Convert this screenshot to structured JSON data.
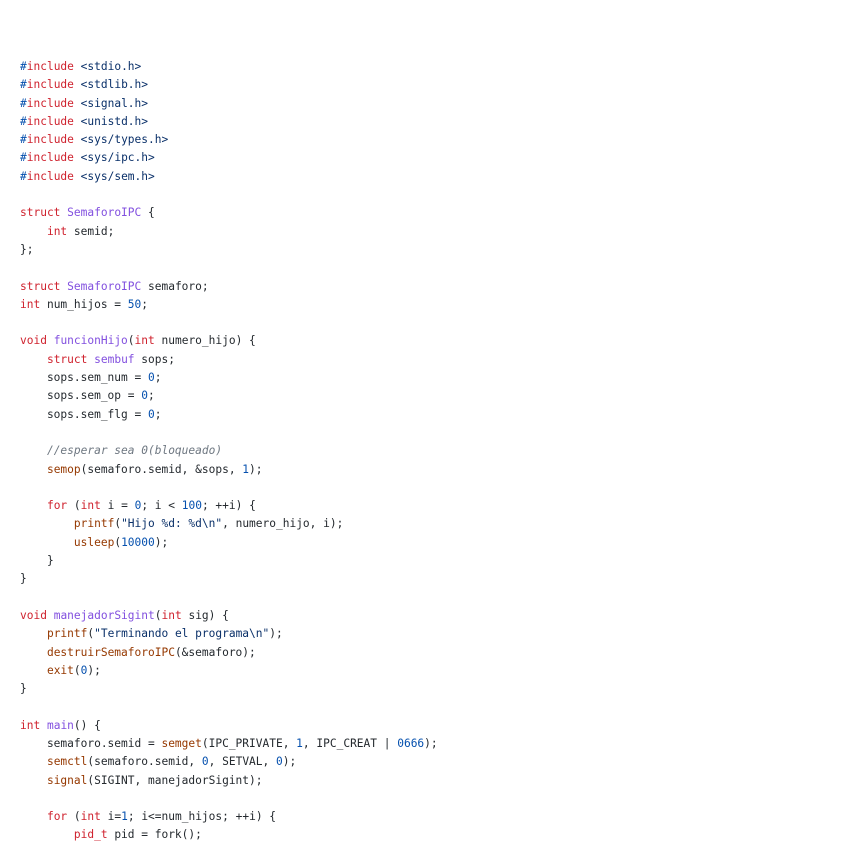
{
  "colors": {
    "background": "#ffffff",
    "text": "#24292e",
    "keyword": "#cf222e",
    "preprocessor": "#0550ae",
    "type_name": "#8250df",
    "function_call": "#953800",
    "number": "#0550ae",
    "string": "#0a3069",
    "comment": "#6e7781"
  },
  "code": {
    "lines": [
      [
        {
          "c": "pp",
          "t": "#"
        },
        {
          "c": "kw",
          "t": "include"
        },
        {
          "c": "tx",
          "t": " "
        },
        {
          "c": "hdr",
          "t": "<stdio.h>"
        }
      ],
      [
        {
          "c": "pp",
          "t": "#"
        },
        {
          "c": "kw",
          "t": "include"
        },
        {
          "c": "tx",
          "t": " "
        },
        {
          "c": "hdr",
          "t": "<stdlib.h>"
        }
      ],
      [
        {
          "c": "pp",
          "t": "#"
        },
        {
          "c": "kw",
          "t": "include"
        },
        {
          "c": "tx",
          "t": " "
        },
        {
          "c": "hdr",
          "t": "<signal.h>"
        }
      ],
      [
        {
          "c": "pp",
          "t": "#"
        },
        {
          "c": "kw",
          "t": "include"
        },
        {
          "c": "tx",
          "t": " "
        },
        {
          "c": "hdr",
          "t": "<unistd.h>"
        }
      ],
      [
        {
          "c": "pp",
          "t": "#"
        },
        {
          "c": "kw",
          "t": "include"
        },
        {
          "c": "tx",
          "t": " "
        },
        {
          "c": "hdr",
          "t": "<sys/types.h>"
        }
      ],
      [
        {
          "c": "pp",
          "t": "#"
        },
        {
          "c": "kw",
          "t": "include"
        },
        {
          "c": "tx",
          "t": " "
        },
        {
          "c": "hdr",
          "t": "<sys/ipc.h>"
        }
      ],
      [
        {
          "c": "pp",
          "t": "#"
        },
        {
          "c": "kw",
          "t": "include"
        },
        {
          "c": "tx",
          "t": " "
        },
        {
          "c": "hdr",
          "t": "<sys/sem.h>"
        }
      ],
      [],
      [
        {
          "c": "kw",
          "t": "struct"
        },
        {
          "c": "tx",
          "t": " "
        },
        {
          "c": "ty",
          "t": "SemaforoIPC"
        },
        {
          "c": "tx",
          "t": " {"
        }
      ],
      [
        {
          "c": "tx",
          "t": "    "
        },
        {
          "c": "kw",
          "t": "int"
        },
        {
          "c": "tx",
          "t": " semid;"
        }
      ],
      [
        {
          "c": "tx",
          "t": "};"
        }
      ],
      [],
      [
        {
          "c": "kw",
          "t": "struct"
        },
        {
          "c": "tx",
          "t": " "
        },
        {
          "c": "ty",
          "t": "SemaforoIPC"
        },
        {
          "c": "tx",
          "t": " semaforo;"
        }
      ],
      [
        {
          "c": "kw",
          "t": "int"
        },
        {
          "c": "tx",
          "t": " num_hijos = "
        },
        {
          "c": "num",
          "t": "50"
        },
        {
          "c": "tx",
          "t": ";"
        }
      ],
      [],
      [
        {
          "c": "kw",
          "t": "void"
        },
        {
          "c": "tx",
          "t": " "
        },
        {
          "c": "fd",
          "t": "funcionHijo"
        },
        {
          "c": "tx",
          "t": "("
        },
        {
          "c": "kw",
          "t": "int"
        },
        {
          "c": "tx",
          "t": " numero_hijo) {"
        }
      ],
      [
        {
          "c": "tx",
          "t": "    "
        },
        {
          "c": "kw",
          "t": "struct"
        },
        {
          "c": "tx",
          "t": " "
        },
        {
          "c": "ty",
          "t": "sembuf"
        },
        {
          "c": "tx",
          "t": " sops;"
        }
      ],
      [
        {
          "c": "tx",
          "t": "    sops.sem_num = "
        },
        {
          "c": "num",
          "t": "0"
        },
        {
          "c": "tx",
          "t": ";"
        }
      ],
      [
        {
          "c": "tx",
          "t": "    sops.sem_op = "
        },
        {
          "c": "num",
          "t": "0"
        },
        {
          "c": "tx",
          "t": ";"
        }
      ],
      [
        {
          "c": "tx",
          "t": "    sops.sem_flg = "
        },
        {
          "c": "num",
          "t": "0"
        },
        {
          "c": "tx",
          "t": ";"
        }
      ],
      [],
      [
        {
          "c": "tx",
          "t": "    "
        },
        {
          "c": "cm",
          "t": "//esperar sea 0(bloqueado)"
        }
      ],
      [
        {
          "c": "tx",
          "t": "    "
        },
        {
          "c": "fn",
          "t": "semop"
        },
        {
          "c": "tx",
          "t": "(semaforo.semid, &sops, "
        },
        {
          "c": "num",
          "t": "1"
        },
        {
          "c": "tx",
          "t": ");"
        }
      ],
      [],
      [
        {
          "c": "tx",
          "t": "    "
        },
        {
          "c": "kw",
          "t": "for"
        },
        {
          "c": "tx",
          "t": " ("
        },
        {
          "c": "kw",
          "t": "int"
        },
        {
          "c": "tx",
          "t": " i = "
        },
        {
          "c": "num",
          "t": "0"
        },
        {
          "c": "tx",
          "t": "; i < "
        },
        {
          "c": "num",
          "t": "100"
        },
        {
          "c": "tx",
          "t": "; ++i) {"
        }
      ],
      [
        {
          "c": "tx",
          "t": "        "
        },
        {
          "c": "fn",
          "t": "printf"
        },
        {
          "c": "tx",
          "t": "("
        },
        {
          "c": "str",
          "t": "\"Hijo %d: %d\\n\""
        },
        {
          "c": "tx",
          "t": ", numero_hijo, i);"
        }
      ],
      [
        {
          "c": "tx",
          "t": "        "
        },
        {
          "c": "fn",
          "t": "usleep"
        },
        {
          "c": "tx",
          "t": "("
        },
        {
          "c": "num",
          "t": "10000"
        },
        {
          "c": "tx",
          "t": ");"
        }
      ],
      [
        {
          "c": "tx",
          "t": "    }"
        }
      ],
      [
        {
          "c": "tx",
          "t": "}"
        }
      ],
      [],
      [
        {
          "c": "kw",
          "t": "void"
        },
        {
          "c": "tx",
          "t": " "
        },
        {
          "c": "fd",
          "t": "manejadorSigint"
        },
        {
          "c": "tx",
          "t": "("
        },
        {
          "c": "kw",
          "t": "int"
        },
        {
          "c": "tx",
          "t": " sig) {"
        }
      ],
      [
        {
          "c": "tx",
          "t": "    "
        },
        {
          "c": "fn",
          "t": "printf"
        },
        {
          "c": "tx",
          "t": "("
        },
        {
          "c": "str",
          "t": "\"Terminando el programa\\n\""
        },
        {
          "c": "tx",
          "t": ");"
        }
      ],
      [
        {
          "c": "tx",
          "t": "    "
        },
        {
          "c": "fn",
          "t": "destruirSemaforoIPC"
        },
        {
          "c": "tx",
          "t": "(&semaforo);"
        }
      ],
      [
        {
          "c": "tx",
          "t": "    "
        },
        {
          "c": "fn",
          "t": "exit"
        },
        {
          "c": "tx",
          "t": "("
        },
        {
          "c": "num",
          "t": "0"
        },
        {
          "c": "tx",
          "t": ");"
        }
      ],
      [
        {
          "c": "tx",
          "t": "}"
        }
      ],
      [],
      [
        {
          "c": "kw",
          "t": "int"
        },
        {
          "c": "tx",
          "t": " "
        },
        {
          "c": "fd",
          "t": "main"
        },
        {
          "c": "tx",
          "t": "() {"
        }
      ],
      [
        {
          "c": "tx",
          "t": "    semaforo.semid = "
        },
        {
          "c": "fn",
          "t": "semget"
        },
        {
          "c": "tx",
          "t": "(IPC_PRIVATE, "
        },
        {
          "c": "num",
          "t": "1"
        },
        {
          "c": "tx",
          "t": ", IPC_CREAT | "
        },
        {
          "c": "num",
          "t": "0666"
        },
        {
          "c": "tx",
          "t": ");"
        }
      ],
      [
        {
          "c": "tx",
          "t": "    "
        },
        {
          "c": "fn",
          "t": "semctl"
        },
        {
          "c": "tx",
          "t": "(semaforo.semid, "
        },
        {
          "c": "num",
          "t": "0"
        },
        {
          "c": "tx",
          "t": ", SETVAL, "
        },
        {
          "c": "num",
          "t": "0"
        },
        {
          "c": "tx",
          "t": ");"
        }
      ],
      [
        {
          "c": "tx",
          "t": "    "
        },
        {
          "c": "fn",
          "t": "signal"
        },
        {
          "c": "tx",
          "t": "(SIGINT, manejadorSigint);"
        }
      ],
      [],
      [
        {
          "c": "tx",
          "t": "    "
        },
        {
          "c": "kw",
          "t": "for"
        },
        {
          "c": "tx",
          "t": " ("
        },
        {
          "c": "kw",
          "t": "int"
        },
        {
          "c": "tx",
          "t": " i="
        },
        {
          "c": "num",
          "t": "1"
        },
        {
          "c": "tx",
          "t": "; i<=num_hijos; ++i) {"
        }
      ],
      [
        {
          "c": "tx",
          "t": "        "
        },
        {
          "c": "kw",
          "t": "pid_t"
        },
        {
          "c": "tx",
          "t": " pid = fork();"
        }
      ]
    ]
  }
}
